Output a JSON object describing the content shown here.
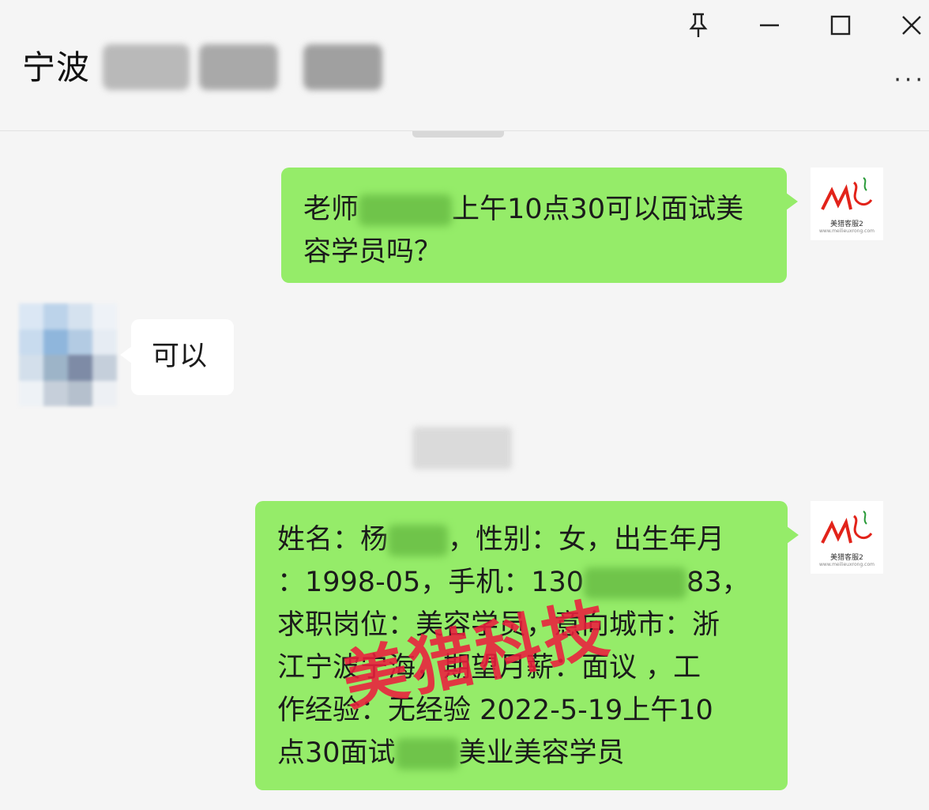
{
  "window": {
    "title": "宁波",
    "pin_icon": "pin-icon",
    "minimize_icon": "minimize-icon",
    "maximize_icon": "maximize-icon",
    "close_icon": "close-icon",
    "more_label": "···"
  },
  "messages": [
    {
      "side": "right",
      "text_before": "老师",
      "text_after": "上午10点30可以面试美容学员吗？"
    },
    {
      "side": "left",
      "text": "可以"
    },
    {
      "side": "right",
      "line1_a": "姓名：杨",
      "line1_b": "，性别：女，出生年月",
      "line2_a": "：1998-05，手机：130",
      "line2_b": "83，",
      "line3": "求职岗位：美容学员，意向城市：浙",
      "line4": "江宁波宁海，期望月薪：面议 ，工",
      "line5": "作经验：无经验 2022-5-19上午10",
      "line6_a": "点30面试",
      "line6_b": "美业美容学员"
    }
  ],
  "avatar_logo": {
    "mark": "ML",
    "text": "美猎客服2",
    "sub": "www.meilieuxrong.com"
  },
  "watermark": "美猎科技",
  "colors": {
    "sent_bubble": "#95ec69",
    "received_bubble": "#ffffff",
    "background": "#f5f5f5",
    "watermark": "#eb1e3c"
  }
}
